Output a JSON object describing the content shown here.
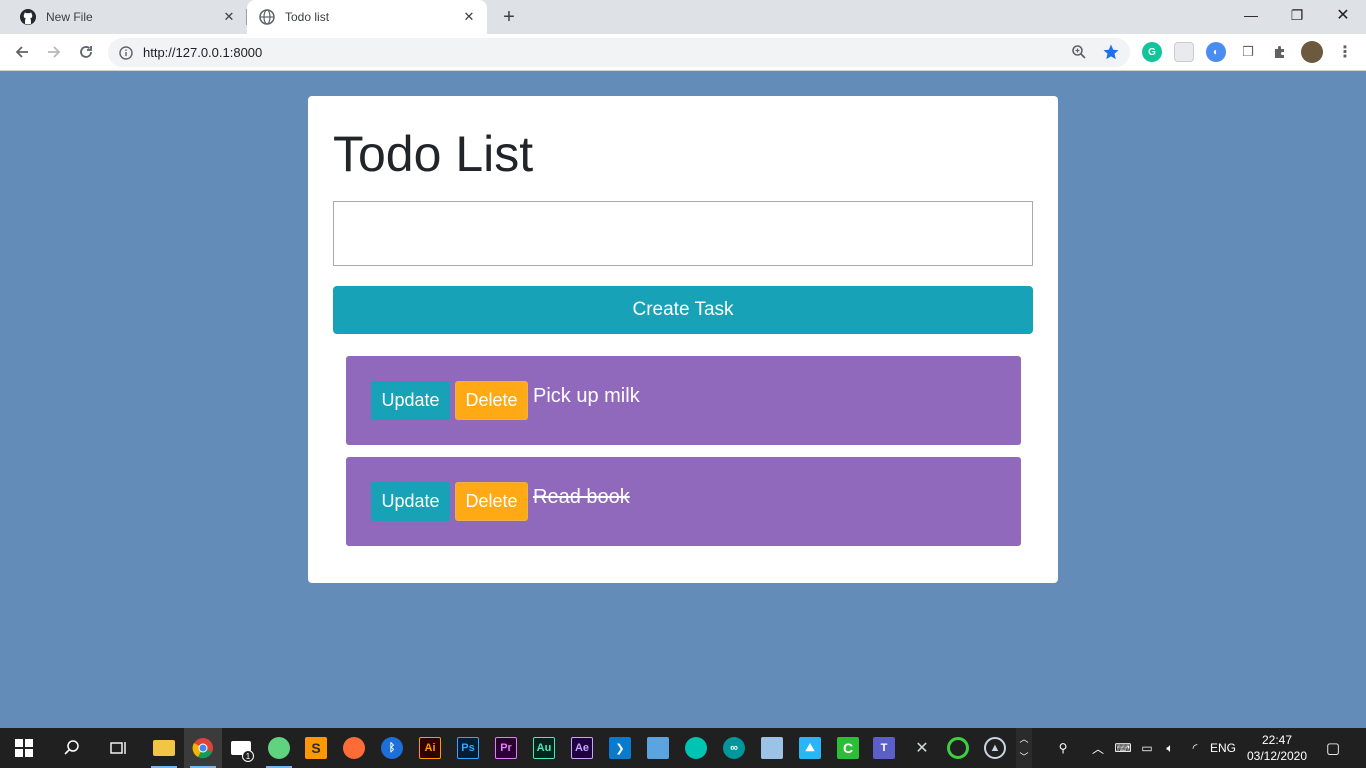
{
  "browser": {
    "tabs": [
      {
        "title": "New File",
        "icon": "github-icon"
      },
      {
        "title": "Todo list",
        "icon": "globe-icon"
      }
    ],
    "url": "http://127.0.0.1:8000"
  },
  "page": {
    "title": "Todo List",
    "input_value": "",
    "create_label": "Create Task",
    "tasks": [
      {
        "text": "Pick up milk",
        "completed": false,
        "update_label": "Update",
        "delete_label": "Delete"
      },
      {
        "text": "Read book",
        "completed": true,
        "update_label": "Update",
        "delete_label": "Delete"
      }
    ]
  },
  "taskbar": {
    "apps": [
      "Ai",
      "Ps",
      "Pr",
      "Au",
      "Ae"
    ],
    "language": "ENG",
    "time": "22:47",
    "date": "03/12/2020",
    "mail_badge": "1"
  },
  "colors": {
    "page_background": "#638cb9",
    "create_button": "#17a2b8",
    "task_row": "#9069bd",
    "update_button": "#17a2b8",
    "delete_button": "#ffa915"
  }
}
